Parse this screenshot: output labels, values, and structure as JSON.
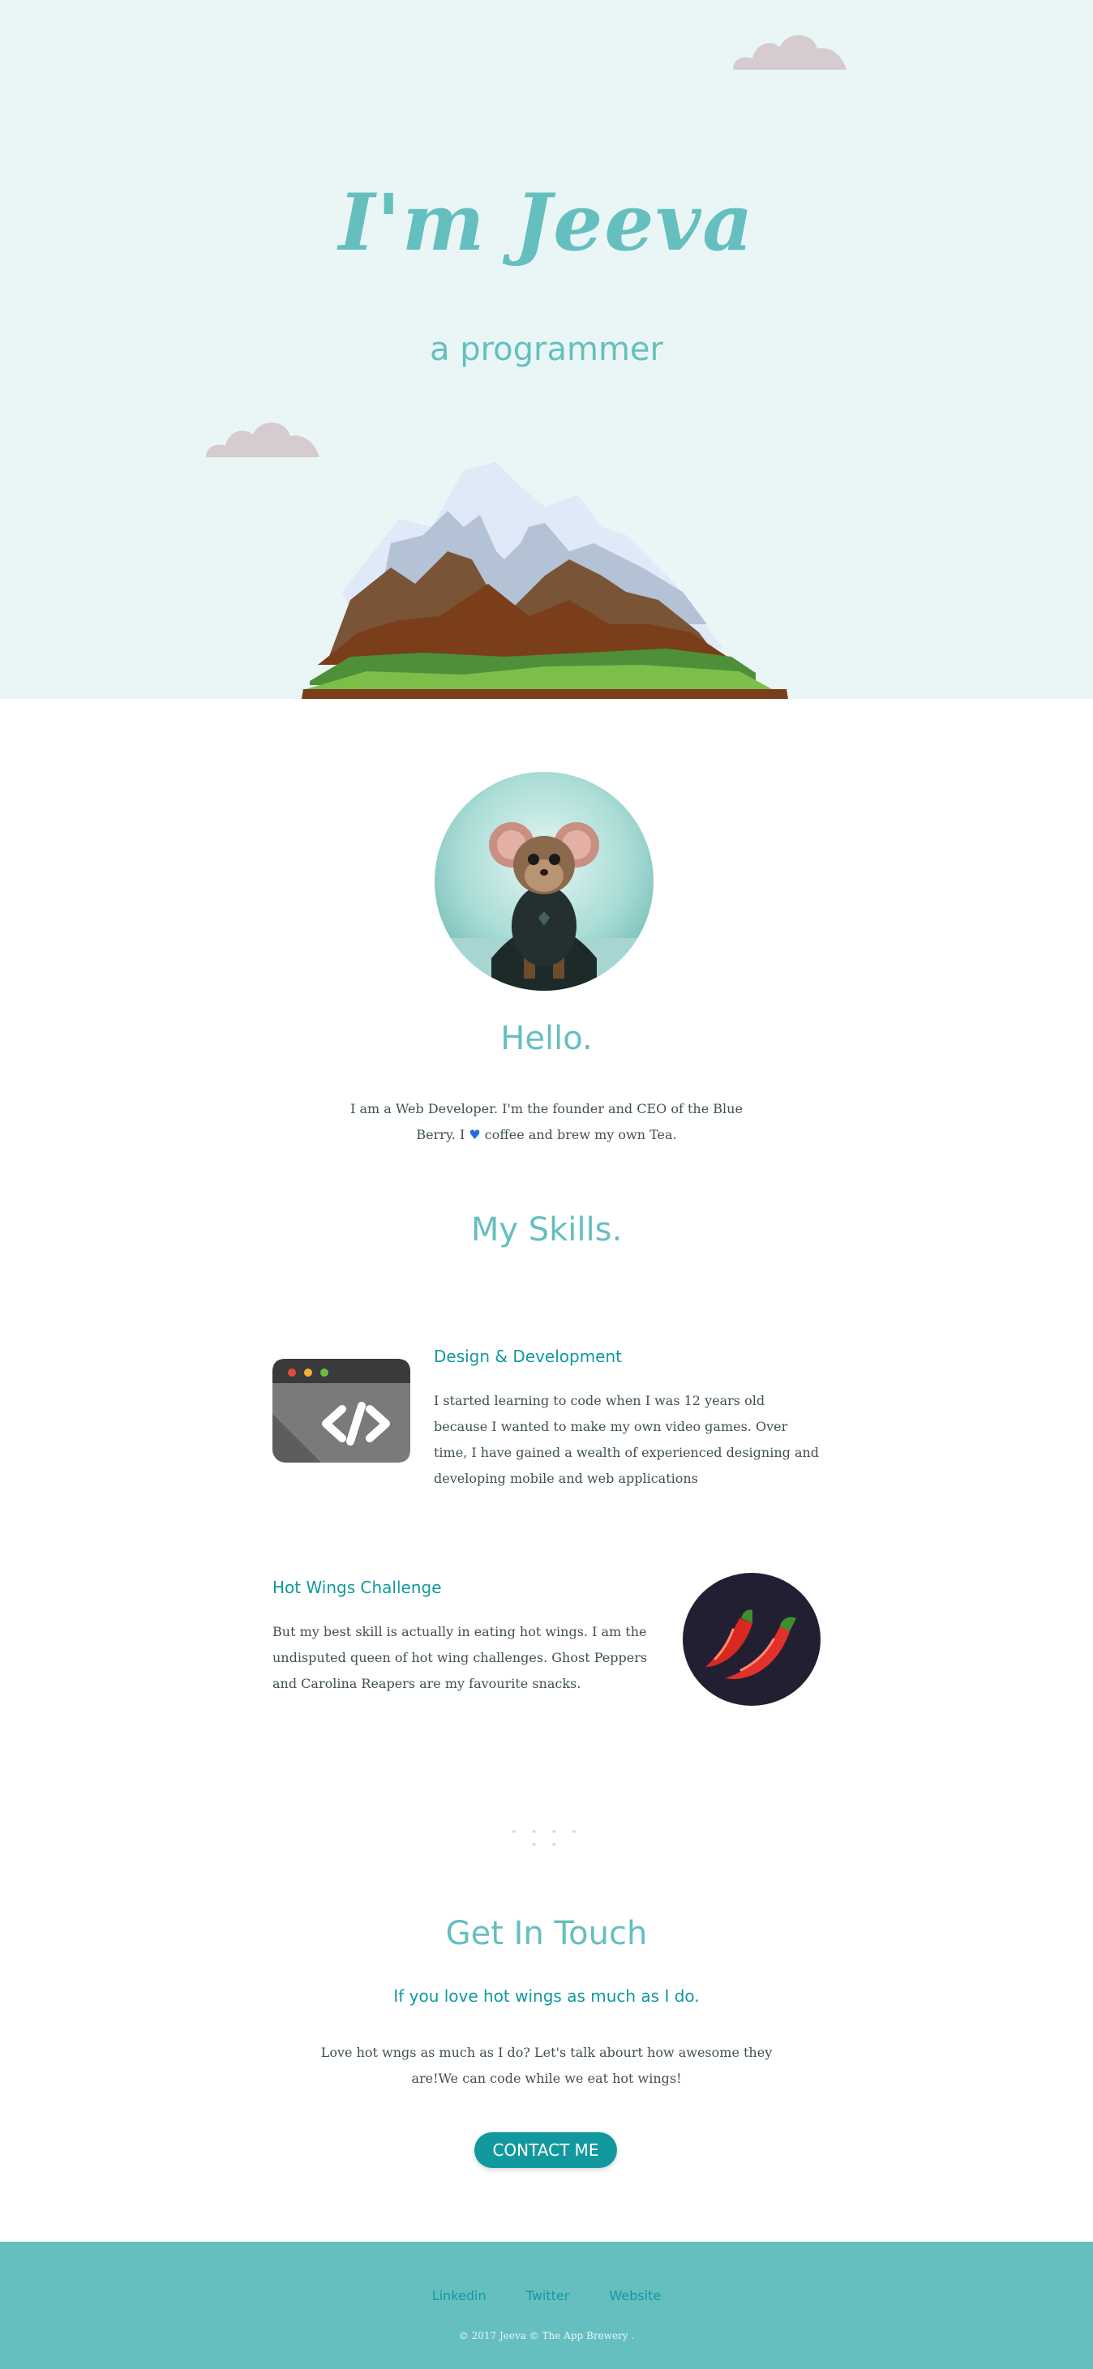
{
  "hero": {
    "title": "I'm Jeeva",
    "subtitle": "a programmer"
  },
  "intro": {
    "heading": "Hello.",
    "text_before_icon": "I am a Web Developer. I'm the founder and CEO of the Blue Berry. I",
    "icon": "heart-icon",
    "text_after_icon": " coffee and brew my own Tea."
  },
  "skills": {
    "heading": "My Skills.",
    "items": [
      {
        "title": "Design & Development",
        "icon": "code-window-icon",
        "text": "I started learning to code when I was 12 years old because I wanted to make my own video games. Over time, I have gained a wealth of experienced designing and developing mobile and web applications"
      },
      {
        "title": "Hot Wings Challenge",
        "icon": "chili-pepper-icon",
        "text": "But my best skill is actually in eating hot wings. I am the undisputed queen of hot wing challenges. Ghost Peppers and Carolina Reapers are my favourite snacks."
      }
    ]
  },
  "divider": "• • • • • •",
  "contact": {
    "heading": "Get In Touch",
    "subheading": "If you love hot wings as much as I do.",
    "text": "Love hot wngs as much as I do? Let's talk abourt how awesome they are!We can code while we eat hot wings!",
    "button_label": "CONTACT ME"
  },
  "footer": {
    "links": [
      "Linkedin",
      "Twitter",
      "Website"
    ],
    "copyright": "© 2017 Jeeva © The App Brewery ."
  },
  "colors": {
    "hero_bg": "#eaf6f6",
    "accent": "#66bfbf",
    "accent_dark": "#11999e",
    "text": "#40514e"
  }
}
